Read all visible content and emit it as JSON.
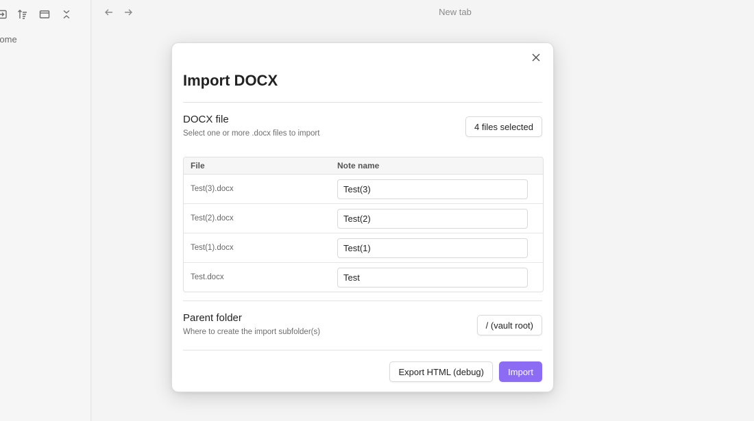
{
  "sidebar": {
    "partial_item": "Home"
  },
  "topbar": {
    "tab_title": "New tab"
  },
  "modal": {
    "title": "Import DOCX",
    "docx_setting": {
      "name": "DOCX file",
      "description": "Select one or more .docx files to import",
      "button_label": "4 files selected"
    },
    "table": {
      "columns": [
        "File",
        "Note name"
      ],
      "rows": [
        {
          "file": "Test(3).docx",
          "note_name": "Test(3)"
        },
        {
          "file": "Test(2).docx",
          "note_name": "Test(2)"
        },
        {
          "file": "Test(1).docx",
          "note_name": "Test(1)"
        },
        {
          "file": "Test.docx",
          "note_name": "Test"
        }
      ]
    },
    "parent_setting": {
      "name": "Parent folder",
      "description": "Where to create the import subfolder(s)",
      "button_label": "/ (vault root)"
    },
    "footer": {
      "export_label": "Export HTML (debug)",
      "import_label": "Import"
    }
  },
  "colors": {
    "accent": "#8d6cf4",
    "background": "#f4f4f4",
    "modal": "#ffffff"
  }
}
